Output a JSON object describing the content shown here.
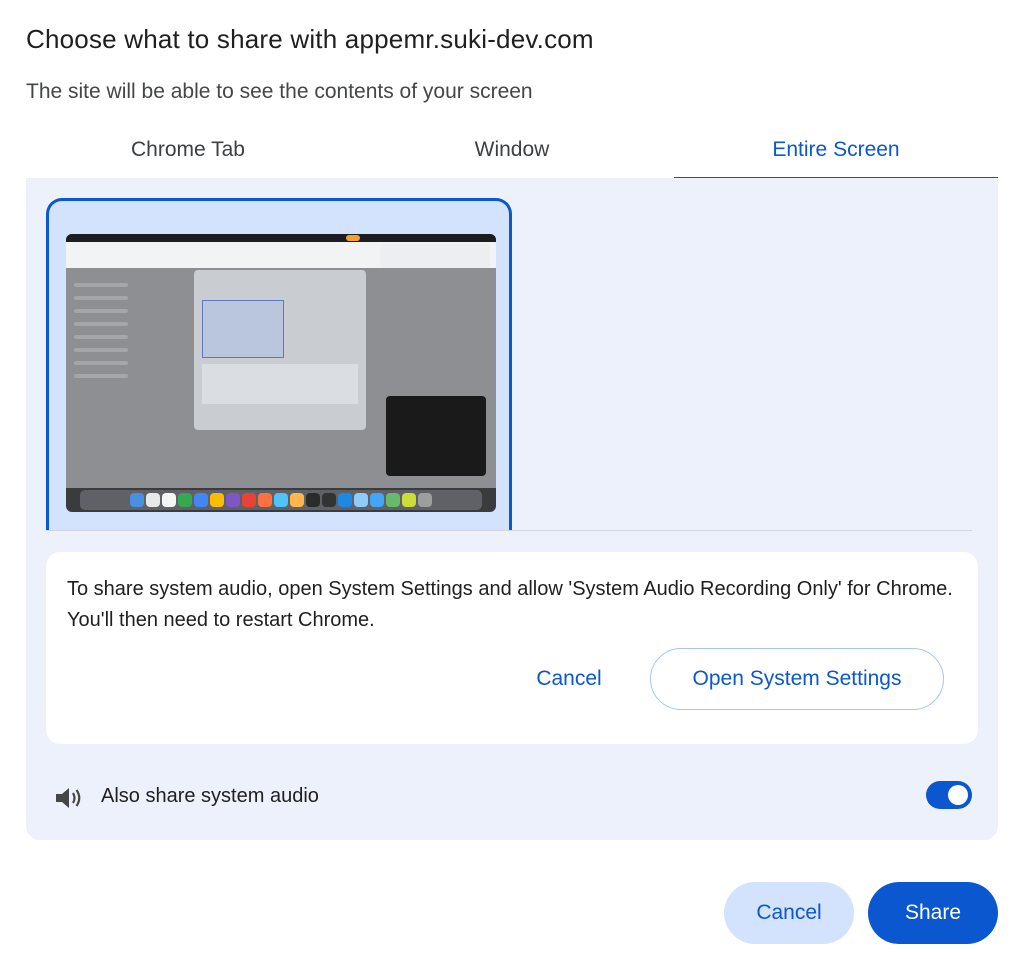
{
  "dialog": {
    "title": "Choose what to share with appemr.suki-dev.com",
    "subtitle": "The site will be able to see the contents of your screen"
  },
  "tabs": [
    {
      "label": "Chrome Tab",
      "active": false
    },
    {
      "label": "Window",
      "active": false
    },
    {
      "label": "Entire Screen",
      "active": true
    }
  ],
  "audio_notice": {
    "message": "To share system audio, open System Settings and allow 'System Audio Recording Only' for Chrome. You'll then need to restart Chrome.",
    "cancel_label": "Cancel",
    "open_settings_label": "Open System Settings"
  },
  "audio_toggle": {
    "label": "Also share system audio",
    "icon": "speaker-icon",
    "enabled": true
  },
  "footer": {
    "cancel_label": "Cancel",
    "share_label": "Share"
  },
  "colors": {
    "accent": "#0b57d0",
    "panel_bg": "#ecf1fb",
    "selected_tile": "#d3e3fd"
  }
}
